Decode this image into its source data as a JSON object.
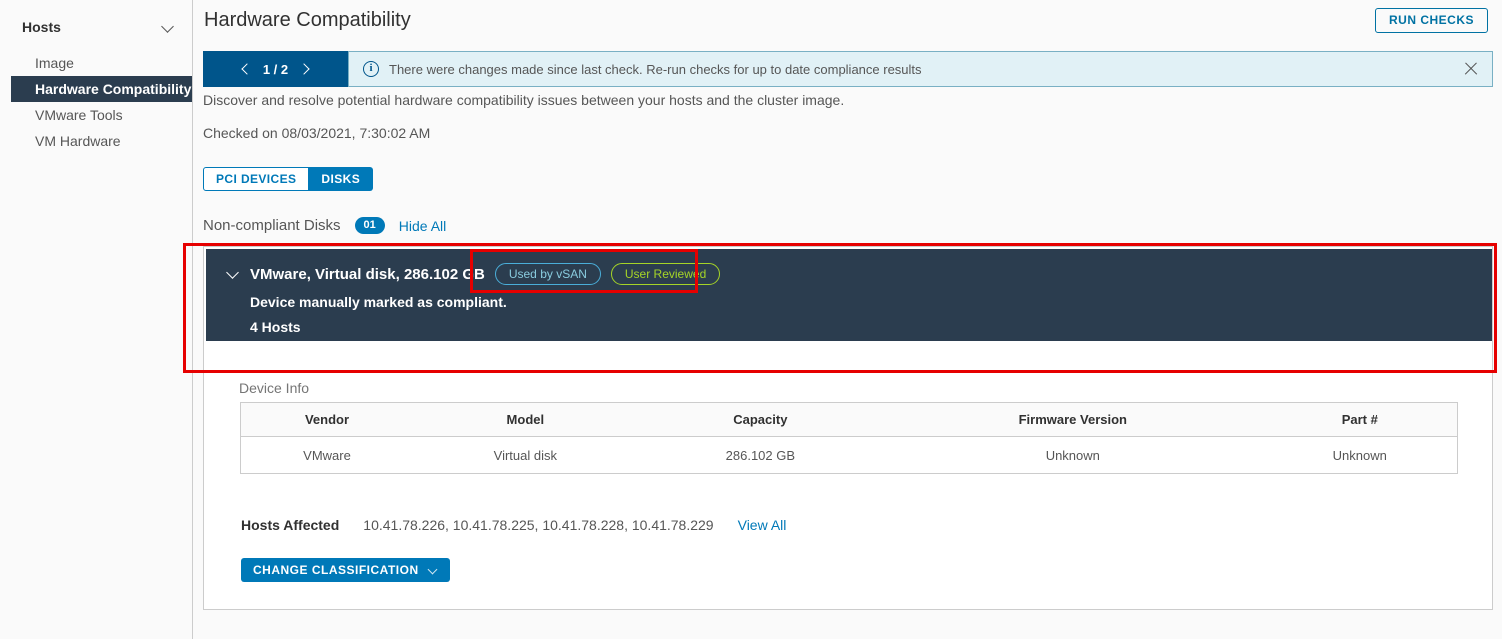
{
  "sidebar": {
    "group_label": "Hosts",
    "collapse_icon": "chevron-down-icon",
    "items": [
      {
        "label": "Image",
        "selected": false
      },
      {
        "label": "Hardware Compatibility",
        "selected": true
      },
      {
        "label": "VMware Tools",
        "selected": false
      },
      {
        "label": "VM Hardware",
        "selected": false
      }
    ]
  },
  "header": {
    "title": "Hardware Compatibility",
    "run_checks_label": "RUN CHECKS"
  },
  "notification": {
    "pager": {
      "current": "1",
      "total": "2",
      "display": "1 / 2",
      "prev_icon": "chevron-left-icon",
      "next_icon": "chevron-right-icon"
    },
    "icon": "info-circle-icon",
    "icon_glyph": "i",
    "message": "There were changes made since last check. Re-run checks for up to date compliance results",
    "close_icon": "close-icon",
    "background": "#e1f1f6",
    "pager_background": "#00558b"
  },
  "description": "Discover and resolve potential hardware compatibility issues between your hosts and the cluster image.",
  "checked_on": "Checked on 08/03/2021, 7:30:02 AM",
  "tabs": [
    {
      "label": "PCI DEVICES",
      "active": false
    },
    {
      "label": "DISKS",
      "active": true
    }
  ],
  "noncompliant": {
    "title": "Non-compliant Disks",
    "count": "01",
    "toggle_label": "Hide All"
  },
  "disk": {
    "caret_icon": "chevron-down-icon",
    "title": "VMware, Virtual disk, 286.102 GB",
    "badges": [
      {
        "label": "Used by vSAN",
        "color": "#89cbde",
        "border": "#4aaed9"
      },
      {
        "label": "User Reviewed",
        "color": "#a5d427",
        "border": "#a5d427"
      }
    ],
    "subtitle": "Device manually marked as compliant.",
    "hosts_count_label": "4 Hosts",
    "background": "#2b3d4f"
  },
  "device_info": {
    "label": "Device Info",
    "columns": [
      "Vendor",
      "Model",
      "Capacity",
      "Firmware Version",
      "Part #"
    ],
    "rows": [
      [
        "VMware",
        "Virtual disk",
        "286.102 GB",
        "Unknown",
        "Unknown"
      ]
    ]
  },
  "hosts_affected": {
    "label": "Hosts Affected",
    "value": "10.41.78.226, 10.41.78.225, 10.41.78.228, 10.41.78.229",
    "view_all_label": "View All"
  },
  "actions": {
    "change_classification_label": "CHANGE CLASSIFICATION",
    "change_classification_caret": "chevron-down-icon"
  },
  "annotations": {
    "outer_color": "#e60000",
    "badges_color": "#e60000"
  }
}
